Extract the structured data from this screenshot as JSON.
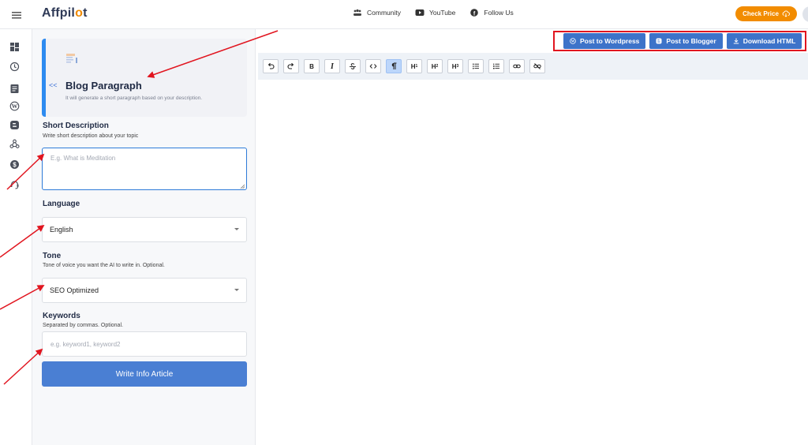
{
  "header": {
    "logo_text_before": "Affpil",
    "logo_o": "o",
    "logo_text_after": "t",
    "nav": [
      {
        "label": "Community",
        "icon": "community-icon"
      },
      {
        "label": "YouTube",
        "icon": "youtube-icon"
      },
      {
        "label": "Follow Us",
        "icon": "facebook-icon"
      }
    ],
    "check_price_label": "Check Price"
  },
  "sidebar": {
    "icons": [
      "dashboard-icon",
      "history-icon",
      "document-icon",
      "wordpress-icon",
      "blogger-icon",
      "webhook-icon",
      "dollar-icon",
      "support-icon"
    ]
  },
  "tool": {
    "collapse_label": "<<",
    "title": "Blog Paragraph",
    "subtitle": "It will generate a short paragraph based on your description."
  },
  "form": {
    "short_description": {
      "label": "Short Description",
      "help": "Write short description about your topic",
      "placeholder": "E.g. What is Meditation",
      "value": ""
    },
    "language": {
      "label": "Language",
      "value": "English"
    },
    "tone": {
      "label": "Tone",
      "help": "Tone of voice you want the AI to write in. Optional.",
      "value": "SEO Optimized"
    },
    "keywords": {
      "label": "Keywords",
      "help": "Separated by commas. Optional.",
      "placeholder": "e.g. keyword1, keyword2",
      "value": ""
    },
    "submit_label": "Write Info Article"
  },
  "actions": {
    "post_wordpress": "Post to Wordpress",
    "post_blogger": "Post to Blogger",
    "download_html": "Download HTML"
  },
  "editor": {
    "toolbar": {
      "bold": "B",
      "italic": "I",
      "heading": "H",
      "h1_level": "1",
      "h2_level": "2",
      "h3_level": "3"
    },
    "content": ""
  },
  "colors": {
    "accent_blue": "#3d73c9",
    "brand_orange": "#f28c00",
    "annotation_red": "#e1151f"
  }
}
